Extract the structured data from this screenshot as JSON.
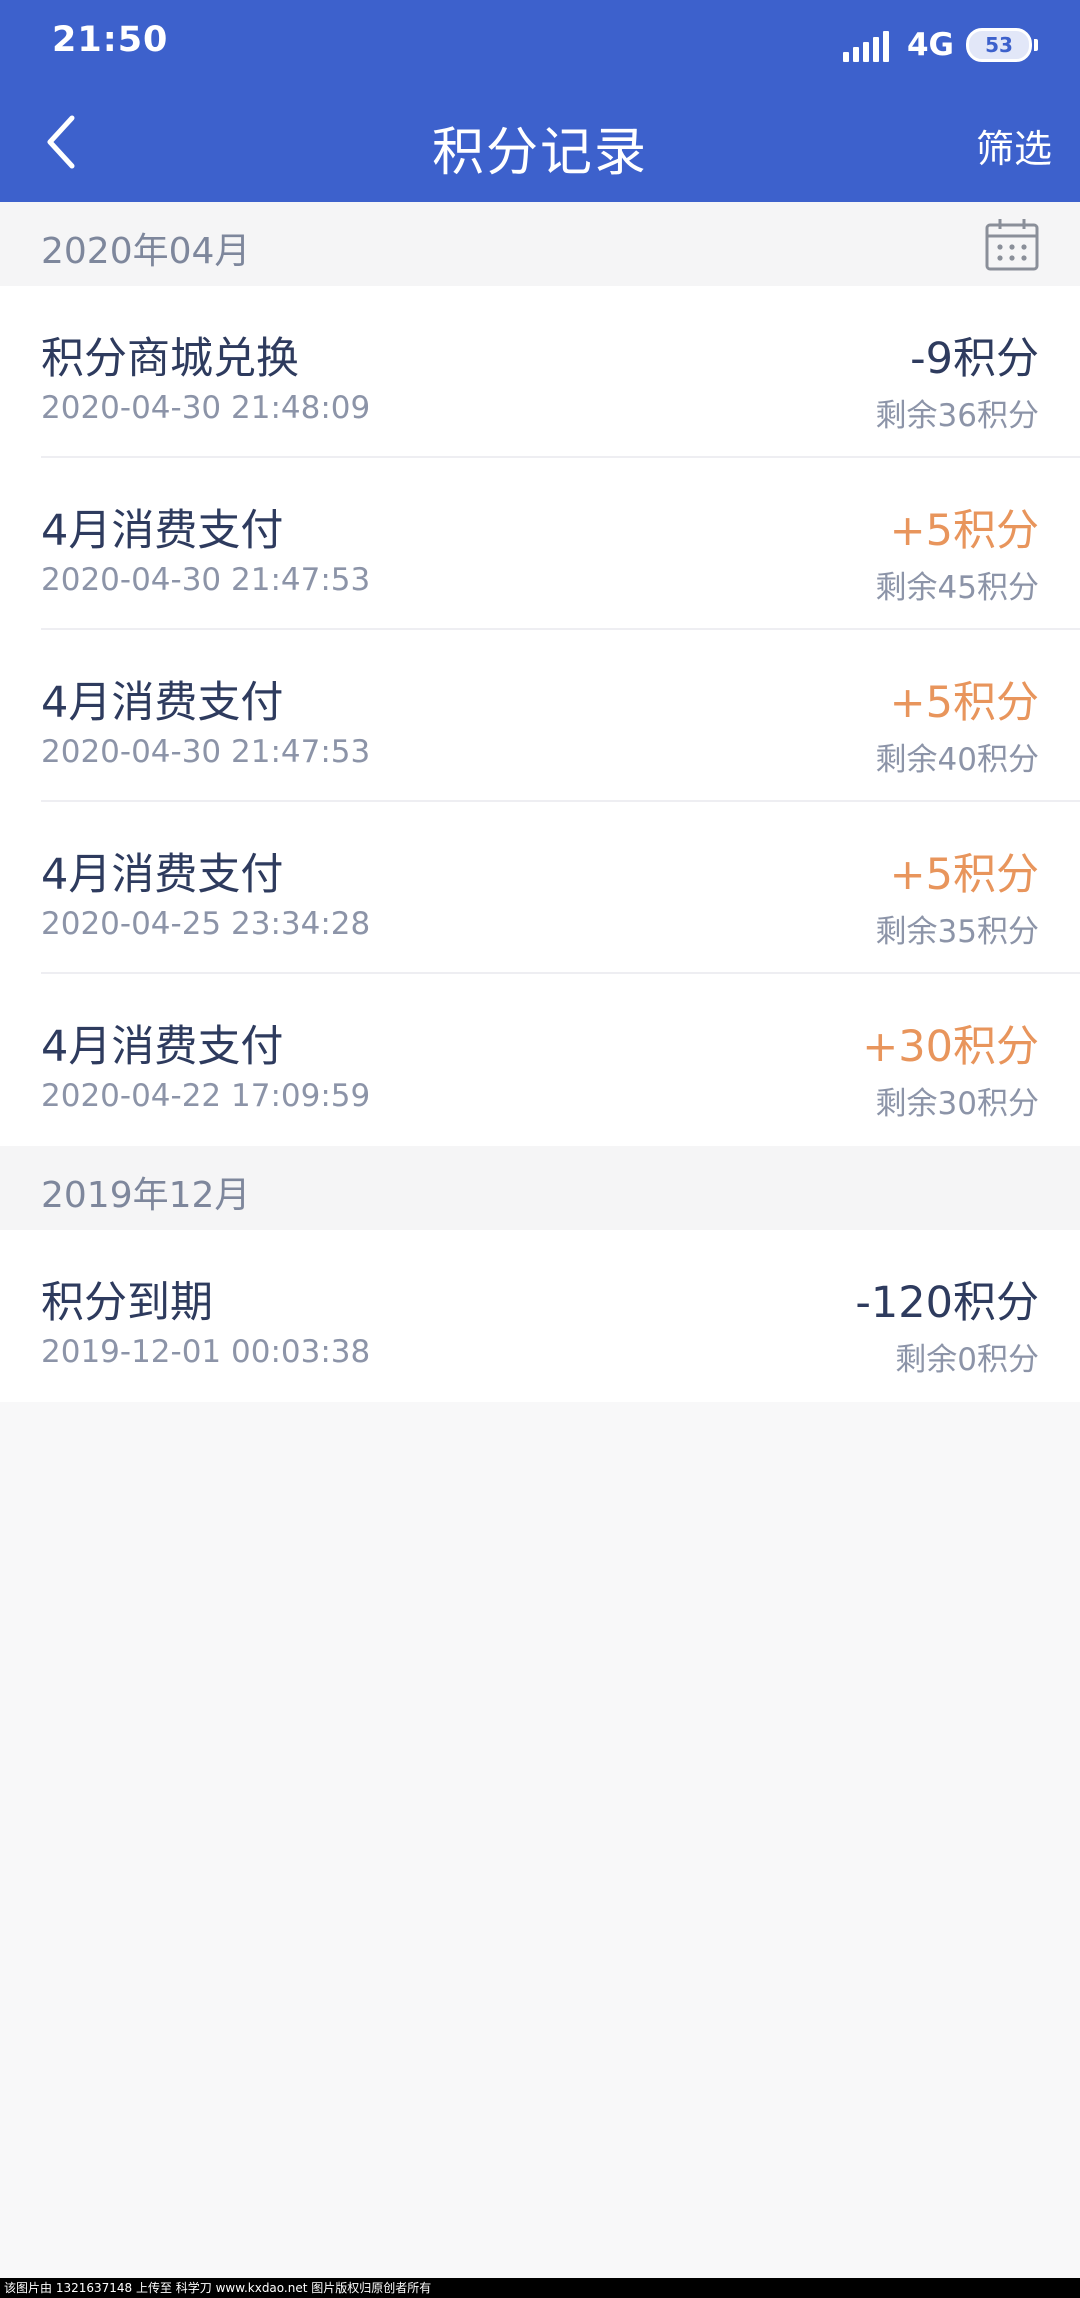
{
  "status_bar": {
    "time": "21:50",
    "network": "4G",
    "battery": "53"
  },
  "header": {
    "title": "积分记录",
    "filter_label": "筛选"
  },
  "groups": [
    {
      "month": "2020年04月",
      "records": [
        {
          "title": "积分商城兑换",
          "time": "2020-04-30 21:48:09",
          "change": "-9积分",
          "remaining": "剩余36积分",
          "type": "neg"
        },
        {
          "title": "4月消费支付",
          "time": "2020-04-30 21:47:53",
          "change": "+5积分",
          "remaining": "剩余45积分",
          "type": "pos"
        },
        {
          "title": "4月消费支付",
          "time": "2020-04-30 21:47:53",
          "change": "+5积分",
          "remaining": "剩余40积分",
          "type": "pos"
        },
        {
          "title": "4月消费支付",
          "time": "2020-04-25 23:34:28",
          "change": "+5积分",
          "remaining": "剩余35积分",
          "type": "pos"
        },
        {
          "title": "4月消费支付",
          "time": "2020-04-22 17:09:59",
          "change": "+30积分",
          "remaining": "剩余30积分",
          "type": "pos"
        }
      ]
    },
    {
      "month": "2019年12月",
      "records": [
        {
          "title": "积分到期",
          "time": "2019-12-01 00:03:38",
          "change": "-120积分",
          "remaining": "剩余0积分",
          "type": "neg"
        }
      ]
    }
  ],
  "footer_text": "该图片由 1321637148 上传至 科学刀 www.kxdao.net 图片版权归原创者所有",
  "colors": {
    "header_bg": "#3d61cc",
    "positive": "#e8955c",
    "negative": "#2e3b5e"
  }
}
